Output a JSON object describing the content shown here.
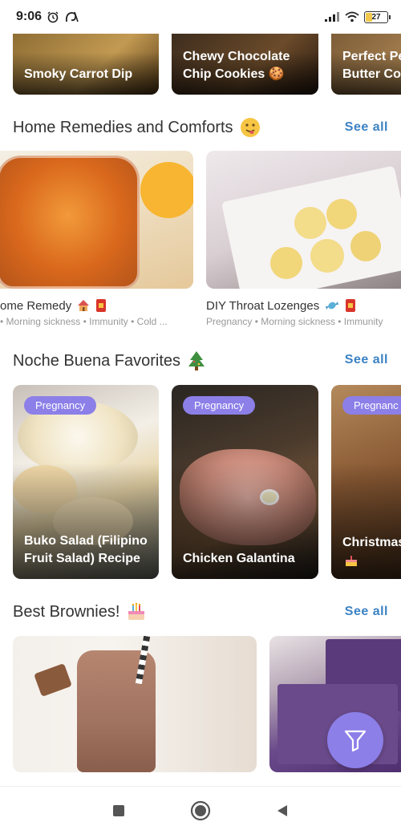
{
  "status": {
    "time": "9:06",
    "battery": "27",
    "battery_level": 0.27
  },
  "top_row": [
    {
      "title": "Smoky Carrot Dip"
    },
    {
      "title": "Chewy Chocolate Chip Cookies 🍪"
    },
    {
      "title": "Perfect Pe Butter Coo"
    }
  ],
  "sections": {
    "remedies": {
      "title": "Home Remedies and Comforts",
      "see_all": "See all",
      "items": [
        {
          "title": "ome Remedy",
          "tags": "• Morning sickness • Immunity • Cold ..."
        },
        {
          "title": "DIY Throat Lozenges",
          "tags": "Pregnancy • Morning sickness • Immunity"
        }
      ]
    },
    "noche": {
      "title": "Noche Buena Favorites",
      "see_all": "See all",
      "items": [
        {
          "tag": "Pregnancy",
          "title": "Buko Salad (Filipino Fruit Salad) Recipe"
        },
        {
          "tag": "Pregnancy",
          "title": "Chicken Galantina"
        },
        {
          "tag": "Pregnanc",
          "title": "Christmas"
        }
      ]
    },
    "brownies": {
      "title": "Best Brownies!",
      "see_all": "See all"
    }
  },
  "colors": {
    "accent": "#8c7fe8",
    "link": "#3b82c4"
  },
  "icons": {
    "alarm": "alarm-icon",
    "filter": "filter-icon",
    "home": "home-circle-icon",
    "back": "back-triangle-icon",
    "recents": "recents-square-icon"
  }
}
